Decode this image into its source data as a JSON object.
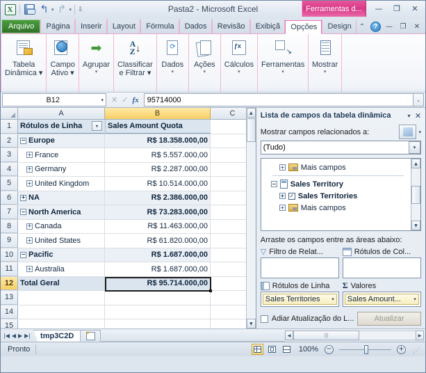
{
  "window": {
    "title": "Pasta2  -  Microsoft Excel",
    "contextual_tab_header": "Ferramentas d...",
    "quick_access": {
      "excel_logo": "X",
      "save_icon": "save-icon",
      "undo_icon": "↰",
      "redo_icon": "↱",
      "customize_icon": "▾"
    },
    "controls": {
      "minimize": "—",
      "restore": "❐",
      "close": "✕"
    }
  },
  "ribbon": {
    "tabs": [
      {
        "label": "Arquivo",
        "kind": "file"
      },
      {
        "label": "Página ",
        "kind": "normal"
      },
      {
        "label": "Inserir",
        "kind": "normal"
      },
      {
        "label": "Layout ",
        "kind": "normal"
      },
      {
        "label": "Fórmula",
        "kind": "normal"
      },
      {
        "label": "Dados",
        "kind": "normal"
      },
      {
        "label": "Revisão",
        "kind": "normal"
      },
      {
        "label": "Exibiçã",
        "kind": "normal"
      },
      {
        "label": "Opções",
        "kind": "active"
      },
      {
        "label": "Design",
        "kind": "ctx"
      }
    ],
    "right_controls": {
      "collapse_ribbon": "⌃",
      "help": "?",
      "minimize": "—",
      "restore": "❐",
      "close": "✕"
    },
    "groups": [
      {
        "label": "Tabela\nDinâmica ▾",
        "icon": "pivot-table-icon"
      },
      {
        "label": "Campo\nAtivo ▾",
        "icon": "active-field-icon"
      },
      {
        "label": "Agrupar",
        "icon": "group-icon",
        "caret": "▾"
      },
      {
        "label": "Classificar\ne Filtrar ▾",
        "icon": "sort-filter-icon"
      },
      {
        "label": "Dados",
        "icon": "data-icon",
        "caret": "▾"
      },
      {
        "label": "Ações",
        "icon": "actions-icon",
        "caret": "▾"
      },
      {
        "label": "Cálculos",
        "icon": "calculations-icon",
        "caret": "▾"
      },
      {
        "label": "Ferramentas",
        "icon": "tools-icon",
        "caret": "▾"
      },
      {
        "label": "Mostrar",
        "icon": "show-icon",
        "caret": "▾"
      }
    ]
  },
  "formula_bar": {
    "name_box": "B12",
    "cancel_icon": "✕",
    "enter_icon": "✓",
    "fx_icon": "fx",
    "formula_value": "95714000",
    "expand_icon": "⌄"
  },
  "grid": {
    "columns": [
      {
        "id": "A",
        "label": "A",
        "selected": false
      },
      {
        "id": "B",
        "label": "B",
        "selected": true
      },
      {
        "id": "C",
        "label": "C",
        "selected": false
      }
    ],
    "rows": [
      {
        "num": "1",
        "a": "Rótulos de Linha",
        "b": "Sales Amount Quota",
        "style": "header"
      },
      {
        "num": "2",
        "a": "Europe",
        "b": "R$ 18.358.000,00",
        "style": "level0",
        "toggle": "−"
      },
      {
        "num": "3",
        "a": "France",
        "b": "R$ 5.557.000,00",
        "style": "level1",
        "toggle": "+"
      },
      {
        "num": "4",
        "a": "Germany",
        "b": "R$ 2.287.000,00",
        "style": "level1",
        "toggle": "+"
      },
      {
        "num": "5",
        "a": "United Kingdom",
        "b": "R$ 10.514.000,00",
        "style": "level1",
        "toggle": "+"
      },
      {
        "num": "6",
        "a": "NA",
        "b": "R$ 2.386.000,00",
        "style": "level0",
        "toggle": "+"
      },
      {
        "num": "7",
        "a": "North America",
        "b": "R$ 73.283.000,00",
        "style": "level0",
        "toggle": "−"
      },
      {
        "num": "8",
        "a": "Canada",
        "b": "R$ 11.463.000,00",
        "style": "level1",
        "toggle": "+"
      },
      {
        "num": "9",
        "a": "United States",
        "b": "R$ 61.820.000,00",
        "style": "level1",
        "toggle": "+"
      },
      {
        "num": "10",
        "a": "Pacific",
        "b": "R$ 1.687.000,00",
        "style": "level0",
        "toggle": "−"
      },
      {
        "num": "11",
        "a": "Australia",
        "b": "R$ 1.687.000,00",
        "style": "level1",
        "toggle": "+"
      },
      {
        "num": "12",
        "a": "Total Geral",
        "b": "R$ 95.714.000,00",
        "style": "grand",
        "toggle": ""
      },
      {
        "num": "13",
        "a": "",
        "b": "",
        "style": "empty",
        "toggle": ""
      },
      {
        "num": "14",
        "a": "",
        "b": "",
        "style": "empty",
        "toggle": ""
      },
      {
        "num": "15",
        "a": "",
        "b": "",
        "style": "empty",
        "toggle": ""
      }
    ],
    "selected_cell": "B12",
    "header_filter_icon": "▾"
  },
  "field_list": {
    "title": "Lista de campos da tabela dinâmica",
    "menu_icon": "▾",
    "close_icon": "✕",
    "show_fields_label": "Mostrar campos relacionados a:",
    "show_fields_button_icon": "cube-icon",
    "show_fields_button_caret": "▾",
    "selected_source": "(Tudo)",
    "dropdown_caret": "▾",
    "items": [
      {
        "label": "Mais campos",
        "toggle": "+",
        "icon": "folder-icon",
        "bold": false,
        "indent": true,
        "checkbox": null
      },
      {
        "label": "Sales Territory",
        "toggle": "−",
        "icon": "table-icon",
        "bold": true,
        "indent": false,
        "checkbox": null
      },
      {
        "label": "Sales Territories",
        "toggle": "+",
        "icon": null,
        "bold": true,
        "indent": true,
        "checkbox": "✓"
      },
      {
        "label": "Mais campos",
        "toggle": "+",
        "icon": "folder-icon",
        "bold": false,
        "indent": true,
        "checkbox": null
      }
    ],
    "drag_label": "Arraste os campos entre as áreas abaixo:",
    "areas": [
      {
        "name": "report-filter",
        "label": "Filtro de Relat...",
        "icon": "filter-icon",
        "pill": null
      },
      {
        "name": "column-labels",
        "label": "Rótulos de Col...",
        "icon": "column-grid-icon",
        "pill": null
      },
      {
        "name": "row-labels",
        "label": "Rótulos de Linha",
        "icon": "row-grid-icon",
        "pill": "Sales Territories"
      },
      {
        "name": "values",
        "label": "Valores",
        "icon": "sigma-icon",
        "pill": "Sales Amount..."
      }
    ],
    "pill_caret": "▾",
    "defer_label": "Adiar Atualização do L...",
    "update_button": "Atualizar"
  },
  "sheet_tabs": {
    "nav": {
      "first": "|◀",
      "prev": "◀",
      "next": "▶",
      "last": "▶|"
    },
    "tabs": [
      "tmp3C2D"
    ],
    "new_sheet_icon": "new-sheet-icon"
  },
  "status_bar": {
    "state": "Pronto",
    "views": [
      {
        "name": "normal-view",
        "icon": "grid-icon",
        "active": true
      },
      {
        "name": "page-layout-view",
        "icon": "page-icon",
        "active": false
      },
      {
        "name": "page-break-view",
        "icon": "break-icon",
        "active": false
      }
    ],
    "zoom": "100%",
    "zoom_out_icon": "−",
    "zoom_in_icon": "+"
  }
}
